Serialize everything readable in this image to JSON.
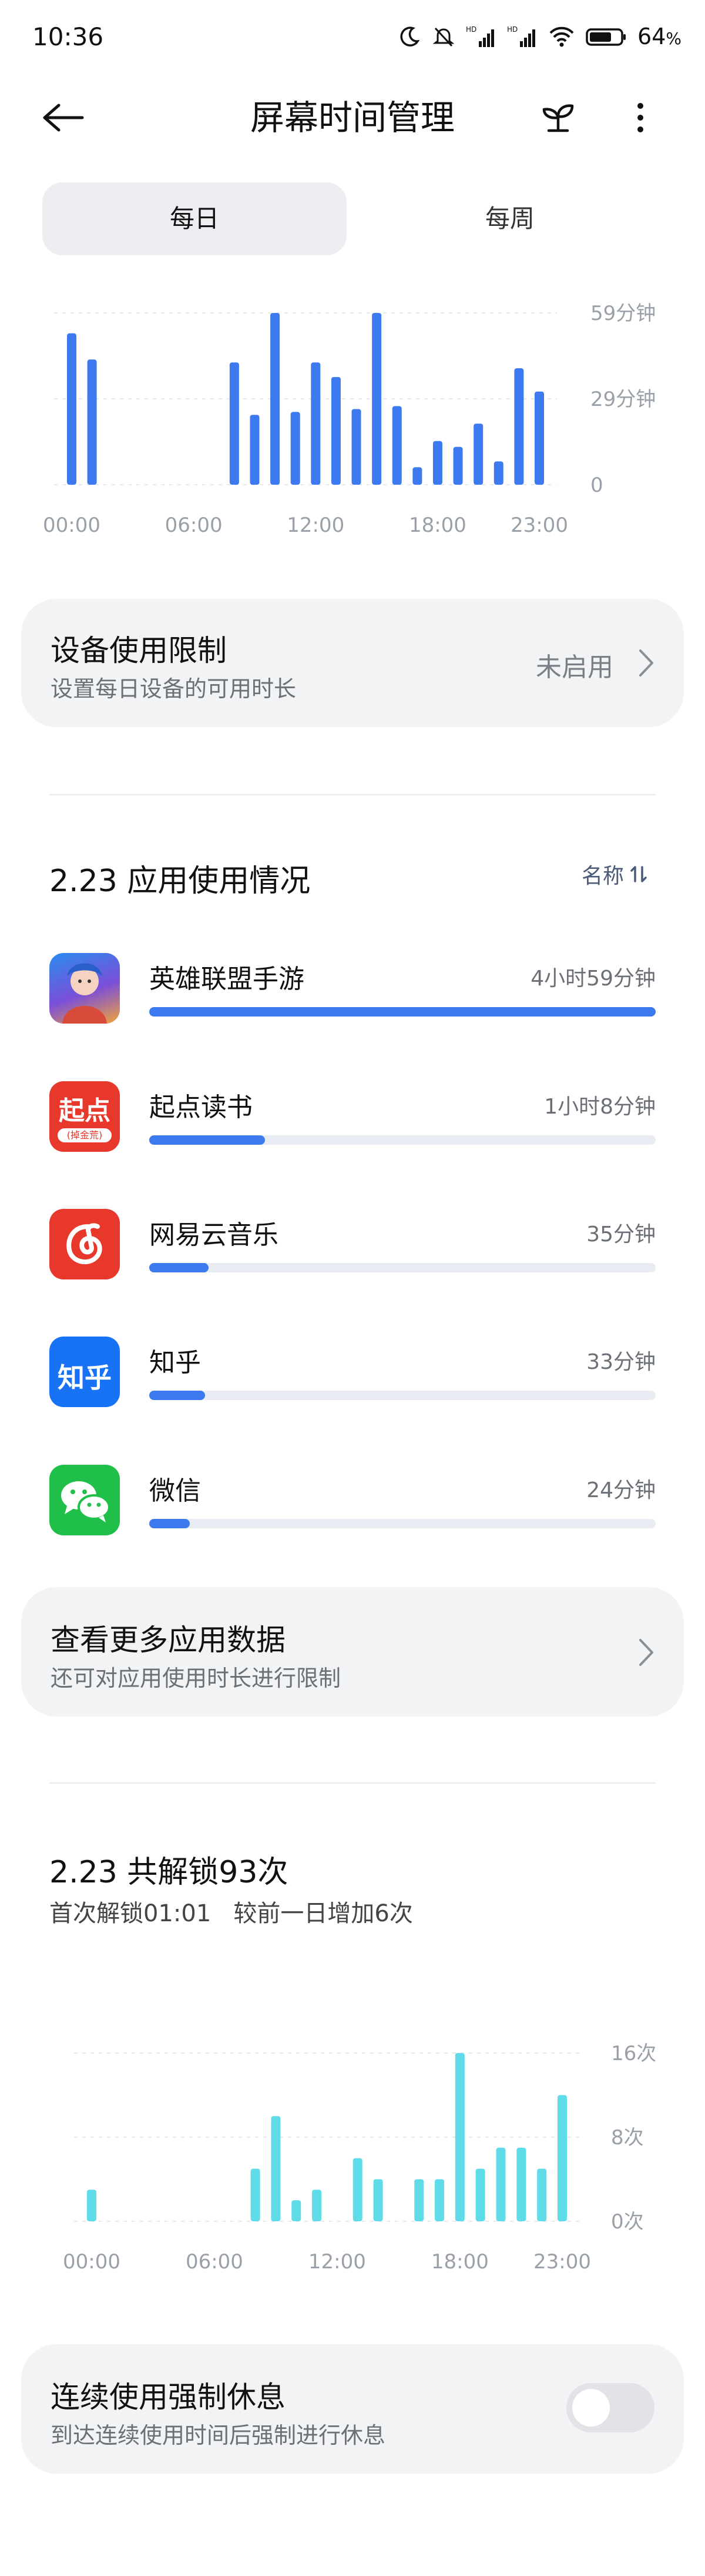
{
  "status_bar": {
    "time": "10:36",
    "battery_percent": "64",
    "battery_suffix": "%",
    "icons": [
      "moon-icon",
      "bell-off-icon",
      "hd-signal-icon",
      "hd-signal-icon",
      "wifi-icon",
      "battery-icon"
    ]
  },
  "header": {
    "title": "屏幕时间管理",
    "back_icon": "back-arrow-icon",
    "plant_icon": "sprout-icon",
    "more_icon": "more-vertical-icon"
  },
  "tabs": [
    {
      "label": "每日",
      "selected": true
    },
    {
      "label": "每周",
      "selected": false
    }
  ],
  "usage_chart": {
    "y_labels": [
      "59分钟",
      "29分钟",
      "0"
    ],
    "x_labels": [
      "00:00",
      "06:00",
      "12:00",
      "18:00",
      "23:00"
    ]
  },
  "device_limit": {
    "title": "设备使用限制",
    "subtitle": "设置每日设备的可用时长",
    "status": "未启用"
  },
  "app_usage": {
    "title": "2.23 应用使用情况",
    "sort_label": "名称",
    "apps": [
      {
        "name": "英雄联盟手游",
        "time": "4小时59分钟",
        "fraction": 1.0,
        "icon": "league-of-legends-icon",
        "color": "#3d7af0"
      },
      {
        "name": "起点读书",
        "time": "1小时8分钟",
        "fraction": 0.228,
        "icon": "qidian-icon",
        "color": "#e8372b"
      },
      {
        "name": "网易云音乐",
        "time": "35分钟",
        "fraction": 0.117,
        "icon": "netease-music-icon",
        "color": "#e8372b"
      },
      {
        "name": "知乎",
        "time": "33分钟",
        "fraction": 0.11,
        "icon": "zhihu-icon",
        "color": "#1772f6"
      },
      {
        "name": "微信",
        "time": "24分钟",
        "fraction": 0.08,
        "icon": "wechat-icon",
        "color": "#1fbf4a"
      }
    ],
    "zhihu_icon_text": "知乎",
    "qidian_icon_text": "起点",
    "qidian_icon_sub": "(掉金荒)"
  },
  "more_data": {
    "title": "查看更多应用数据",
    "subtitle": "还可对应用使用时长进行限制"
  },
  "unlock": {
    "title": "2.23 共解锁93次",
    "subtitle": "首次解锁01:01   较前一日增加6次",
    "y_labels": [
      "16次",
      "8次",
      "0次"
    ],
    "x_labels": [
      "00:00",
      "06:00",
      "12:00",
      "18:00",
      "23:00"
    ]
  },
  "forced_rest": {
    "title": "连续使用强制休息",
    "subtitle": "到达连续使用时间后强制进行休息",
    "enabled": false
  },
  "chart_data": [
    {
      "type": "bar",
      "categories": [
        "0",
        "1",
        "2",
        "3",
        "4",
        "5",
        "6",
        "7",
        "8",
        "9",
        "10",
        "11",
        "12",
        "13",
        "14",
        "15",
        "16",
        "17",
        "18",
        "19",
        "20",
        "21",
        "22",
        "23"
      ],
      "values": [
        52,
        43,
        0,
        0,
        0,
        0,
        0,
        0,
        42,
        24,
        59,
        25,
        42,
        37,
        26,
        59,
        27,
        6,
        15,
        13,
        21,
        8,
        40,
        32
      ],
      "ylim": [
        0,
        59
      ],
      "color": "#3d7af0",
      "ylabel": "",
      "xlabel": "",
      "title": ""
    },
    {
      "type": "bar",
      "categories": [
        "0",
        "1",
        "2",
        "3",
        "4",
        "5",
        "6",
        "7",
        "8",
        "9",
        "10",
        "11",
        "12",
        "13",
        "14",
        "15",
        "16",
        "17",
        "18",
        "19",
        "20",
        "21",
        "22",
        "23"
      ],
      "values": [
        3,
        0,
        0,
        0,
        0,
        0,
        0,
        0,
        5,
        10,
        2,
        3,
        0,
        6,
        4,
        0,
        4,
        4,
        16,
        5,
        7,
        7,
        5,
        12
      ],
      "ylim": [
        0,
        16
      ],
      "color": "#5fdce8",
      "ylabel": "",
      "xlabel": "",
      "title": ""
    }
  ]
}
